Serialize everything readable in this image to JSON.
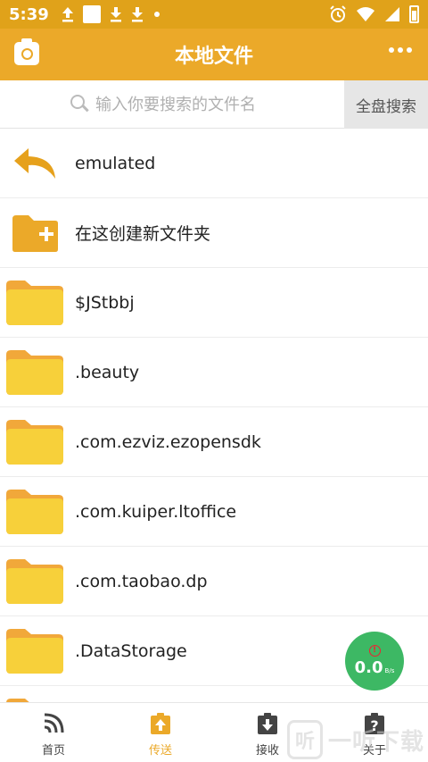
{
  "status_bar": {
    "time": "5:39",
    "left_icons": [
      "upload-icon",
      "image-icon",
      "download-icon",
      "download-icon",
      "dot-icon"
    ],
    "right_icons": [
      "alarm-icon",
      "wifi-icon",
      "signal-icon",
      "battery-icon"
    ]
  },
  "header": {
    "title": "本地文件",
    "camera_icon": "camera-icon",
    "more_icon": "more-icon"
  },
  "search": {
    "placeholder": "输入你要搜索的文件名",
    "value": "",
    "button_label": "全盘搜索"
  },
  "list": {
    "back_label": "emulated",
    "new_folder_label": "在这创建新文件夹",
    "folders": [
      "$JStbbj",
      ".beauty",
      ".com.ezviz.ezopensdk",
      ".com.kuiper.ltoffice",
      ".com.taobao.dp",
      ".DataStorage"
    ]
  },
  "speed": {
    "value": "0.0",
    "unit": "B/s"
  },
  "nav": {
    "items": [
      {
        "label": "首页",
        "icon": "wifi-signal-icon"
      },
      {
        "label": "传送",
        "icon": "send-icon"
      },
      {
        "label": "接收",
        "icon": "receive-icon"
      },
      {
        "label": "关于",
        "icon": "help-icon"
      }
    ],
    "active_index": 1
  },
  "colors": {
    "brand": "#eba929",
    "status_bar": "#e0a21a",
    "folder": "#f7c927",
    "speed_bubble": "#3db864"
  },
  "watermark": {
    "logo_text": "听",
    "text": "一听下载"
  }
}
